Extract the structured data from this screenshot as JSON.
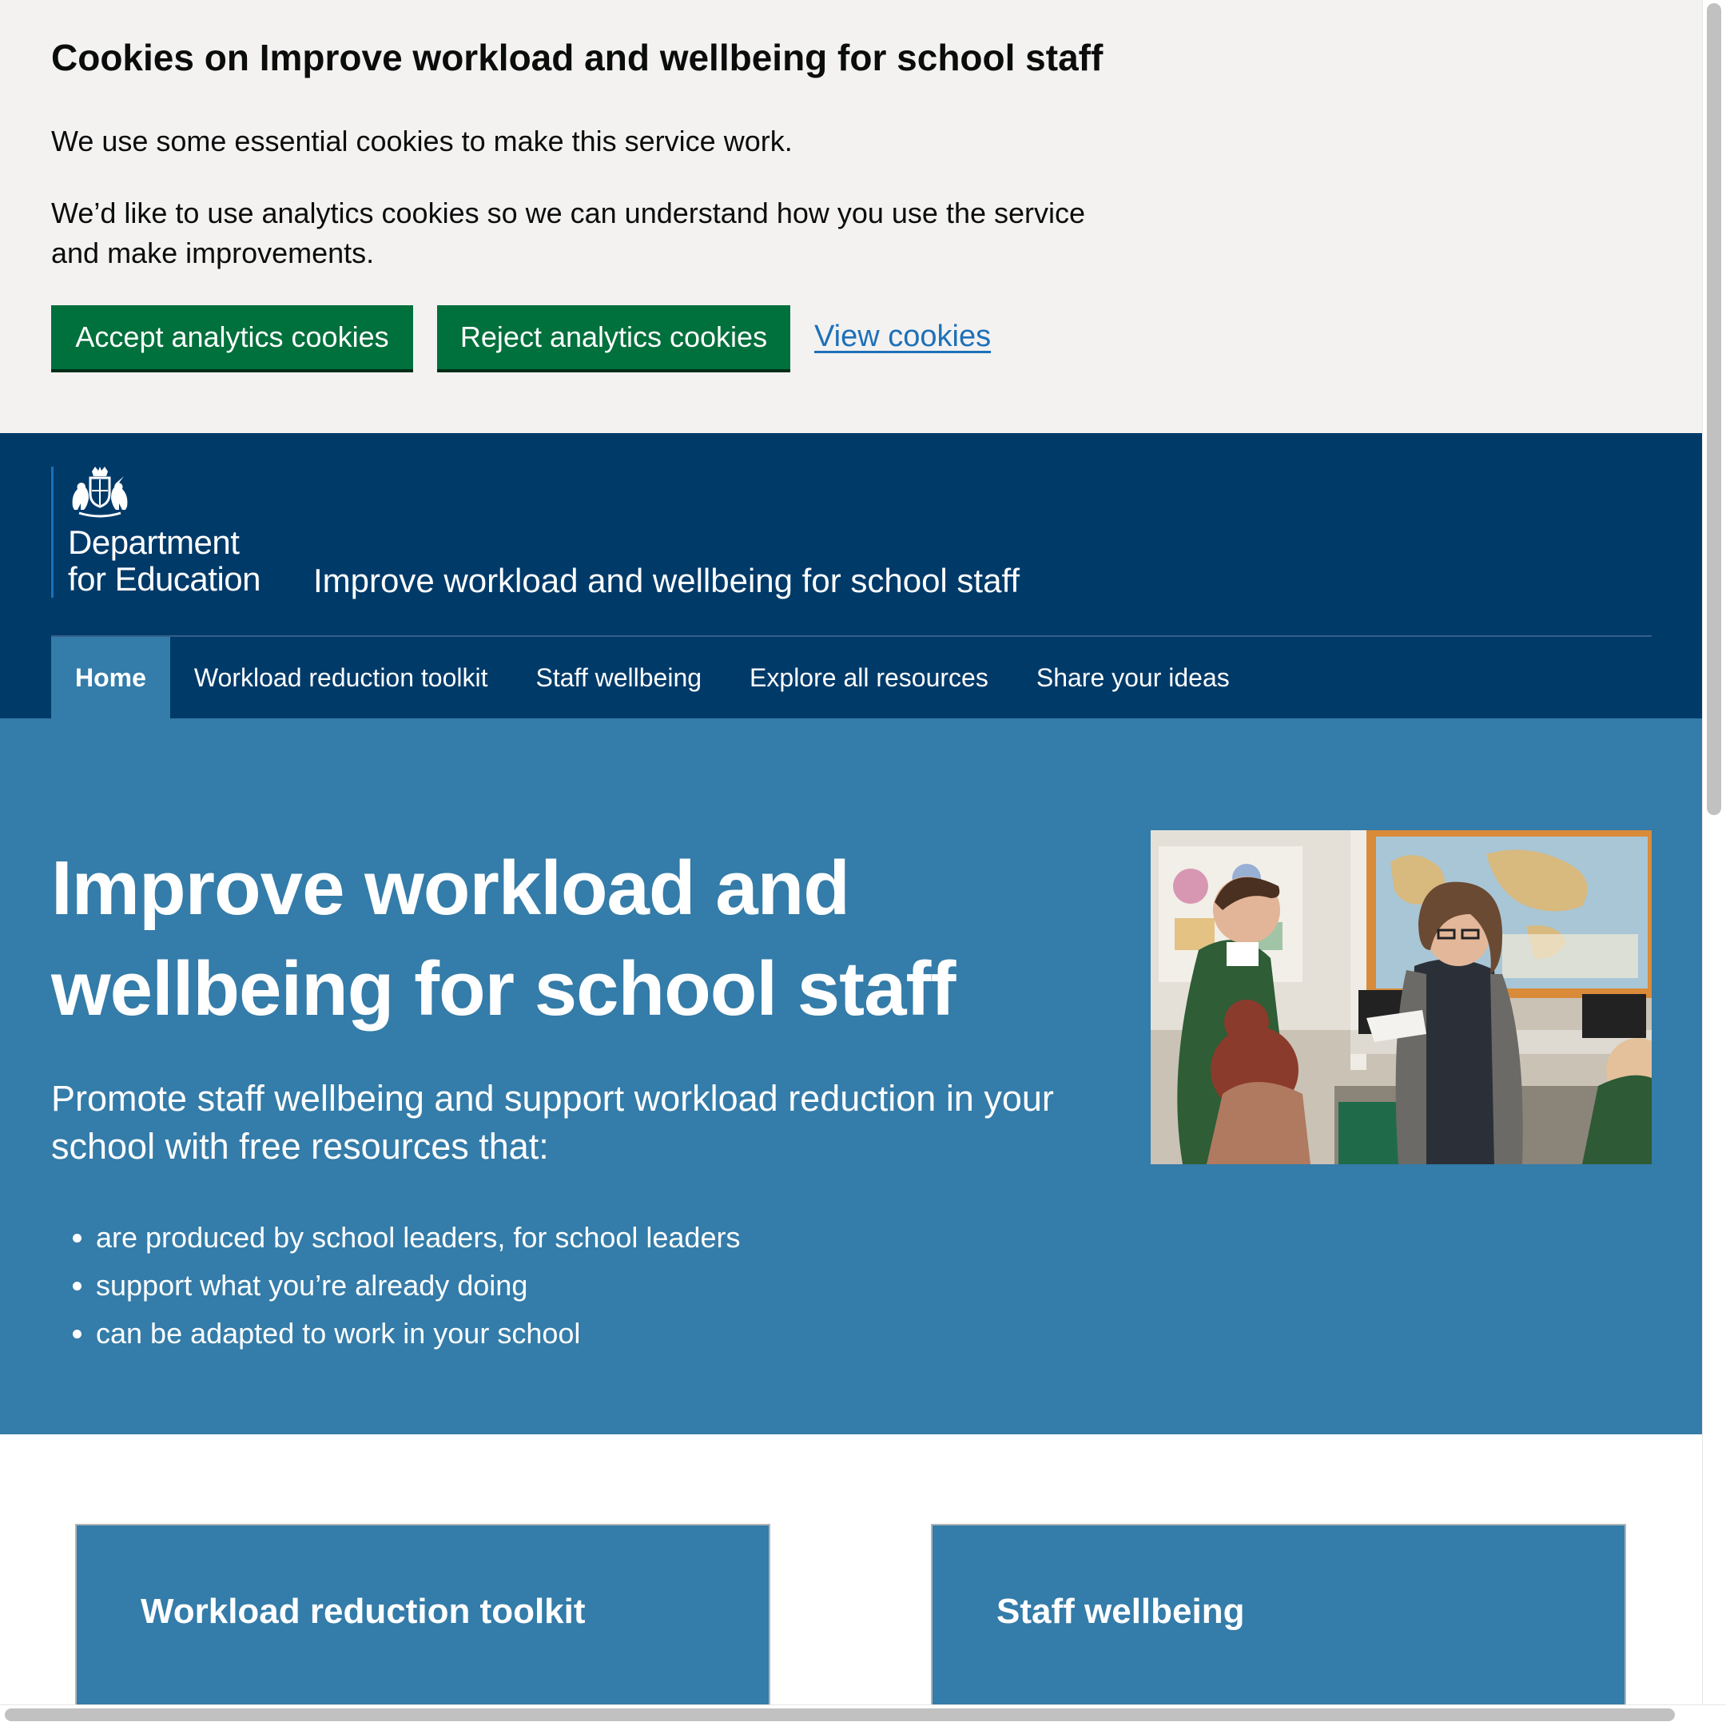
{
  "cookie_banner": {
    "title": "Cookies on Improve workload and wellbeing for school staff",
    "paragraph_1": "We use some essential cookies to make this service work.",
    "paragraph_2": "We’d like to use analytics cookies so we can understand how you use the service and make improvements.",
    "accept_label": "Accept analytics cookies",
    "reject_label": "Reject analytics cookies",
    "view_label": "View cookies"
  },
  "header": {
    "department": "Department\nfor Education",
    "service_name": "Improve workload and wellbeing for school staff",
    "crest_icon": "royal-coat-of-arms-icon"
  },
  "nav": {
    "items": [
      {
        "label": "Home",
        "active": true
      },
      {
        "label": "Workload reduction toolkit",
        "active": false
      },
      {
        "label": "Staff wellbeing",
        "active": false
      },
      {
        "label": "Explore all resources",
        "active": false
      },
      {
        "label": "Share your ideas",
        "active": false
      }
    ]
  },
  "hero": {
    "title": "Improve workload and wellbeing for school staff",
    "lead": "Promote staff wellbeing and support workload reduction in your school with free resources that:",
    "bullets": [
      "are produced by school leaders, for school leaders",
      "support what you’re already doing",
      "can be adapted to work in your school"
    ]
  },
  "cards": [
    {
      "title": "Workload reduction toolkit"
    },
    {
      "title": "Staff wellbeing"
    }
  ],
  "colors": {
    "cookie_bg": "#f3f2f1",
    "button_green": "#00703c",
    "link_blue": "#1d70b8",
    "header_navy": "#003a69",
    "hero_blue": "#347ca9"
  }
}
